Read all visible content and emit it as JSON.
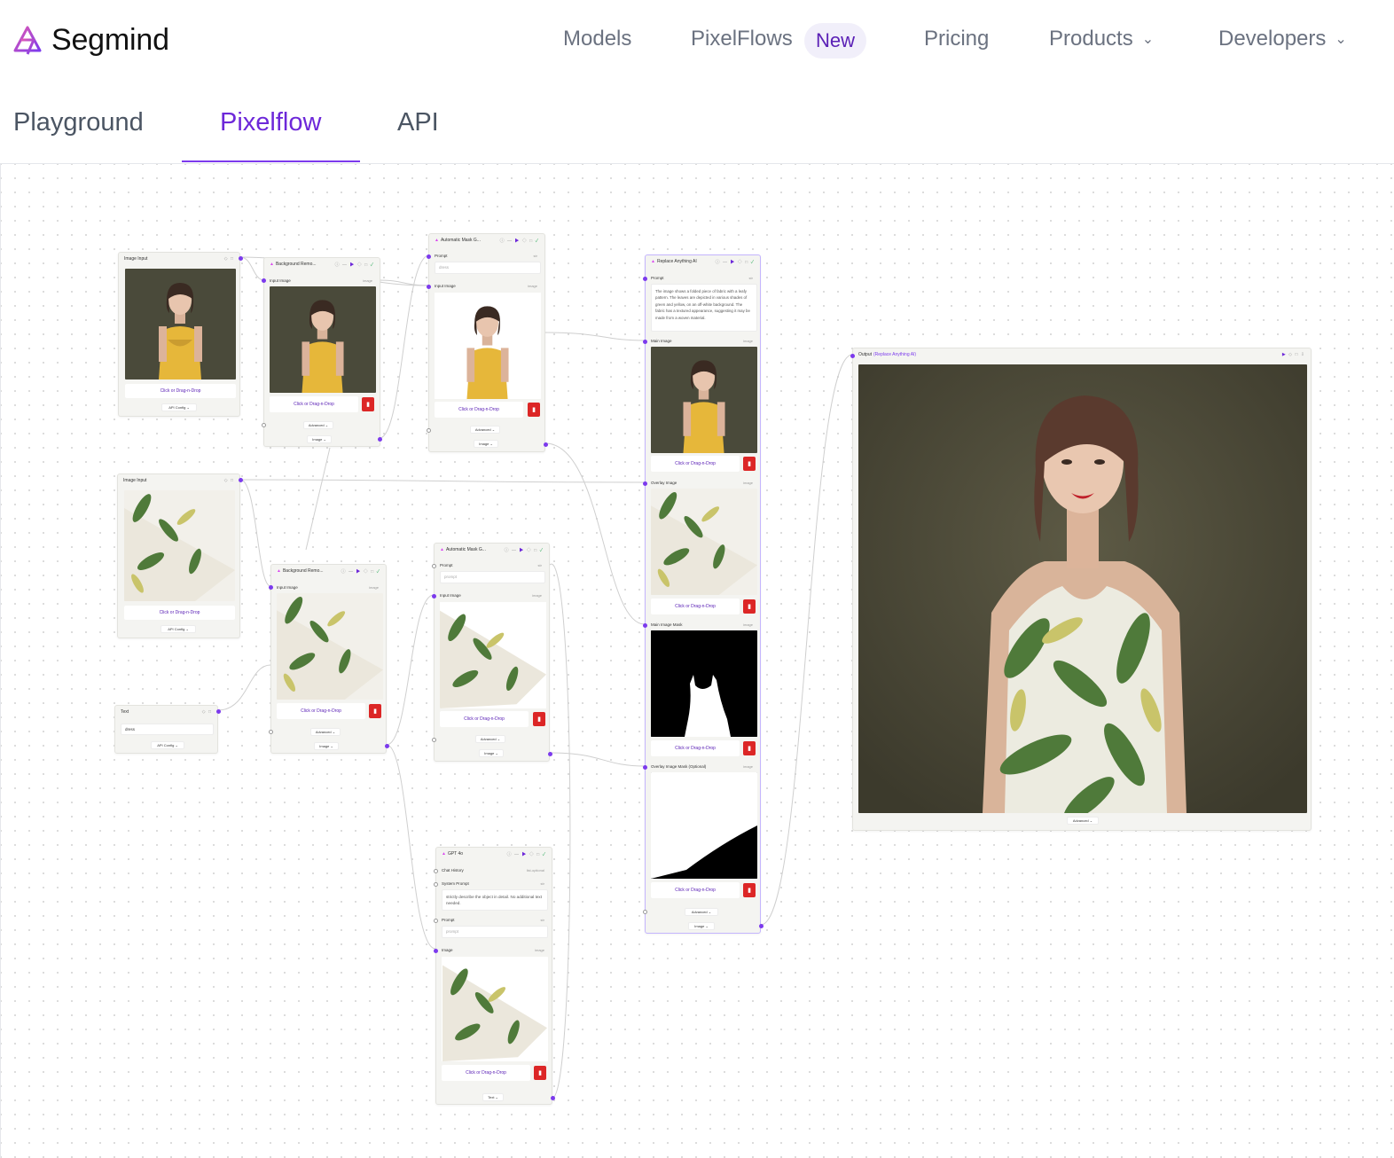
{
  "header": {
    "logo_text": "Segmind",
    "nav": {
      "models": "Models",
      "pixelflows": "PixelFlows",
      "new_badge": "New",
      "pricing": "Pricing",
      "products": "Products",
      "developers": "Developers"
    }
  },
  "tabs": {
    "playground": "Playground",
    "pixelflow": "Pixelflow",
    "api": "API"
  },
  "nodes": {
    "image_input_1": {
      "title": "Image Input",
      "drop": "Click or Drag-n-Drop",
      "config": "API Config"
    },
    "bg_remove_1": {
      "title": "Background Remo...",
      "input_label": "Input Image",
      "input_tag": "image",
      "drop": "Click or Drag-n-Drop",
      "advanced": "Advanced",
      "output": "Image"
    },
    "mask_1": {
      "title": "Automatic Mask G...",
      "prompt_label": "Prompt",
      "prompt_tag": "str",
      "prompt_value": "dress",
      "input_label": "Input Image",
      "input_tag": "image",
      "drop": "Click or Drag-n-Drop",
      "advanced": "Advanced",
      "output": "Image"
    },
    "image_input_2": {
      "title": "Image Input",
      "drop": "Click or Drag-n-Drop",
      "config": "API Config"
    },
    "bg_remove_2": {
      "title": "Background Remo...",
      "input_label": "Input Image",
      "input_tag": "image",
      "drop": "Click or Drag-n-Drop",
      "advanced": "Advanced",
      "output": "Image"
    },
    "text": {
      "title": "Text",
      "value": "dress",
      "config": "API Config"
    },
    "mask_2": {
      "title": "Automatic Mask G...",
      "prompt_label": "Prompt",
      "prompt_tag": "str",
      "prompt_placeholder": "prompt",
      "input_label": "Input Image",
      "input_tag": "image",
      "drop": "Click or Drag-n-Drop",
      "advanced": "Advanced",
      "output": "Image"
    },
    "gpt": {
      "title": "GPT 4o",
      "chat_label": "Chat History",
      "chat_tag": "list-optional",
      "system_label": "System Prompt",
      "system_tag": "str",
      "system_value": "strictly describe the object in detail. No additional text needed.",
      "prompt_label": "Prompt",
      "prompt_tag": "str",
      "prompt_placeholder": "prompt",
      "image_label": "Image",
      "image_tag": "image",
      "drop": "Click or Drag-n-Drop",
      "output": "Text"
    },
    "replace": {
      "title": "Replace Anything AI",
      "prompt_label": "Prompt",
      "prompt_tag": "str",
      "prompt_value": "The image shows a folded piece of fabric with a leafy pattern. The leaves are depicted in various shades of green and yellow, on an off-white background. The fabric has a textured appearance, suggesting it may be made from a woven material.",
      "main_label": "Main Image",
      "main_tag": "image",
      "overlay_label": "Overlay Image",
      "overlay_tag": "image",
      "mask_label": "Main Image Mask",
      "mask_tag": "image",
      "overlay_mask_label": "Overlay Image Mask (Optional)",
      "overlay_mask_tag": "image",
      "drop": "Click or Drag-n-Drop",
      "advanced": "Advanced",
      "output": "Image"
    },
    "output": {
      "title": "Output",
      "source": "(Replace Anything AI)",
      "advanced": "Advanced"
    }
  },
  "colors": {
    "accent": "#6d28d9",
    "delete": "#dc2626",
    "node_bg": "#f4f4f1"
  }
}
